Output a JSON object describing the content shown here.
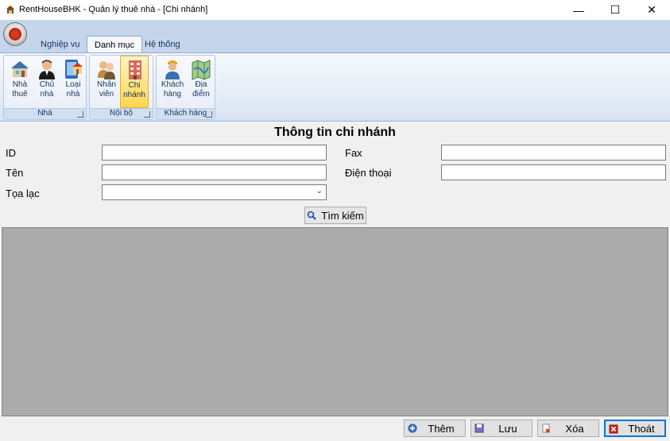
{
  "window": {
    "title": "RentHouseBHK - Quản lý thuê nhà - [Chi nhánh]",
    "controls": {
      "minimize": "—",
      "maximize": "☐",
      "close": "✕"
    }
  },
  "ribbon": {
    "tabs": [
      {
        "label": "Nghiệp vụ",
        "active": false
      },
      {
        "label": "Danh mục",
        "active": true
      },
      {
        "label": "Hệ thống",
        "active": false
      }
    ],
    "groups": [
      {
        "caption": "Nhà",
        "buttons": [
          {
            "label": "Nhà\nthuê",
            "icon": "rental-house-icon"
          },
          {
            "label": "Chủ\nnhà",
            "icon": "owner-icon"
          },
          {
            "label": "Loại\nnhà",
            "icon": "house-type-icon"
          }
        ]
      },
      {
        "caption": "Nội bộ",
        "buttons": [
          {
            "label": "Nhân\nviên",
            "icon": "employees-icon"
          },
          {
            "label": "Chi\nnhánh",
            "icon": "branch-building-icon",
            "selected": true
          }
        ]
      },
      {
        "caption": "Khách hàng",
        "buttons": [
          {
            "label": "Khách\nhàng",
            "icon": "customer-icon"
          },
          {
            "label": "Địa\nđiểm",
            "icon": "map-icon"
          }
        ]
      }
    ]
  },
  "form": {
    "title": "Thông tin chi nhánh",
    "fields": {
      "id": {
        "label": "ID",
        "value": ""
      },
      "name": {
        "label": "Tên",
        "value": ""
      },
      "location": {
        "label": "Tọa lạc",
        "value": ""
      },
      "fax": {
        "label": "Fax",
        "value": ""
      },
      "phone": {
        "label": "Điện thoại",
        "value": ""
      }
    },
    "search_label": "Tìm kiếm"
  },
  "actions": {
    "add": "Thêm",
    "save": "Lưu",
    "delete": "Xóa",
    "exit": "Thoát"
  },
  "colors": {
    "ribbon_header": "#c5d6ec",
    "selected_button": "#ffd64c",
    "grid_background": "#ababab",
    "default_button_border": "#0078d7"
  }
}
